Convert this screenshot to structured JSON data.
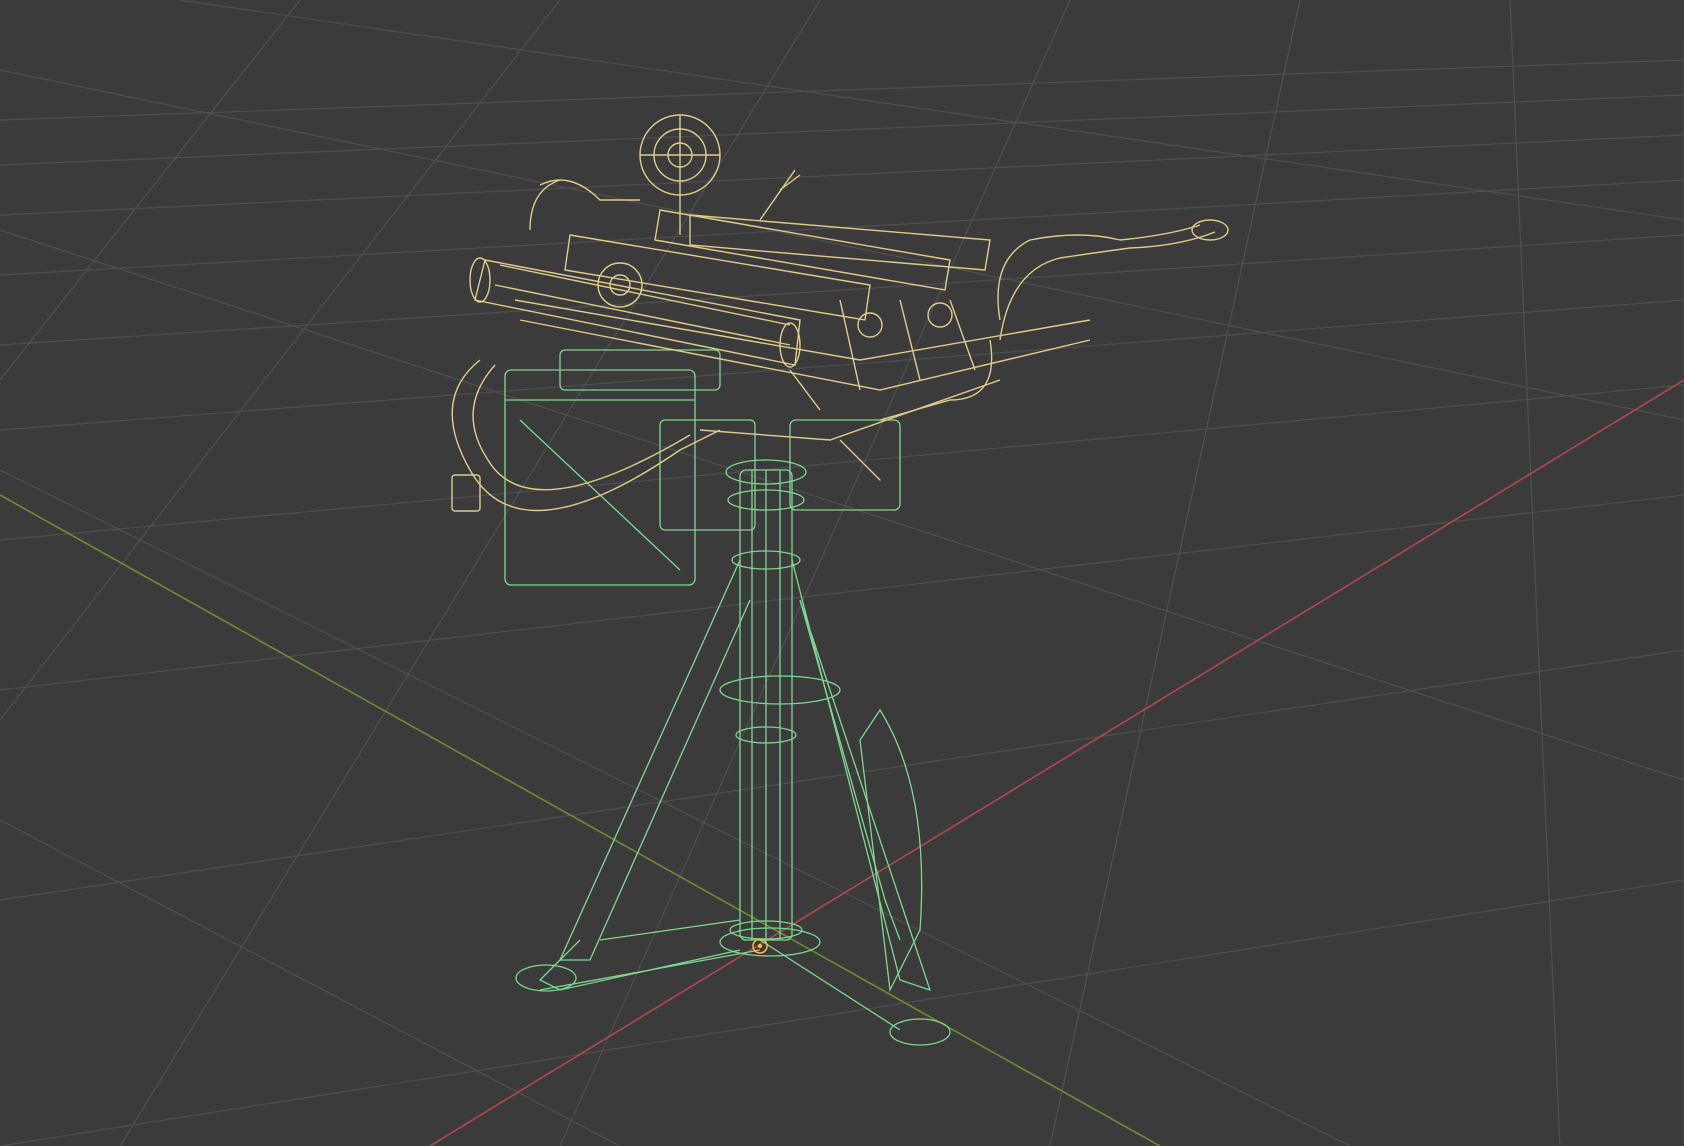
{
  "viewport": {
    "kind": "3d-wireframe-viewport",
    "background": "#3b3b3b",
    "grid_color": "#4f4f4f",
    "x_axis_color": "#b3474f",
    "y_axis_color": "#6e8c34",
    "object_selected_color": "#e0cc8a",
    "object_active_color": "#7fd88f",
    "objects": [
      {
        "name": "gun-assembly",
        "state": "selected"
      },
      {
        "name": "pedestal-tripod-mount",
        "state": "active"
      }
    ],
    "icons": [
      "origin-pivot-icon"
    ]
  }
}
